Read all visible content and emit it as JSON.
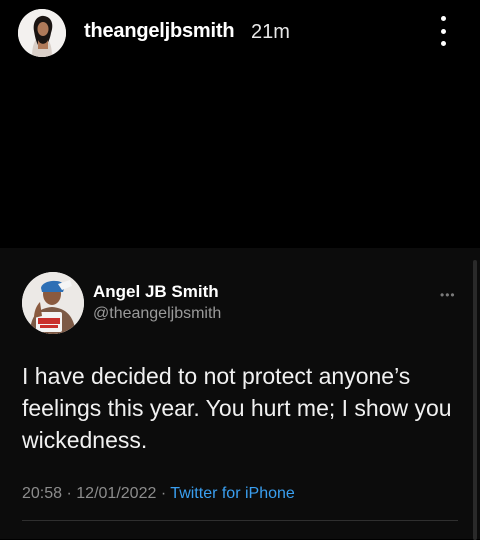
{
  "story": {
    "username": "theangeljbsmith",
    "time": "21m",
    "more_icon": "more-vertical-icon"
  },
  "tweet": {
    "display_name": "Angel JB Smith",
    "handle": "@theangeljbsmith",
    "more_icon": "more-horizontal-icon",
    "text": "I have decided to not protect anyone’s feelings this year. You hurt me; I show you wickedness.",
    "time": "20:58",
    "date": "12/01/2022",
    "source": "Twitter for iPhone"
  },
  "colors": {
    "background": "#000000",
    "card": "#0c0c0c",
    "link": "#3a9ff0",
    "muted": "#8c8c8c"
  }
}
